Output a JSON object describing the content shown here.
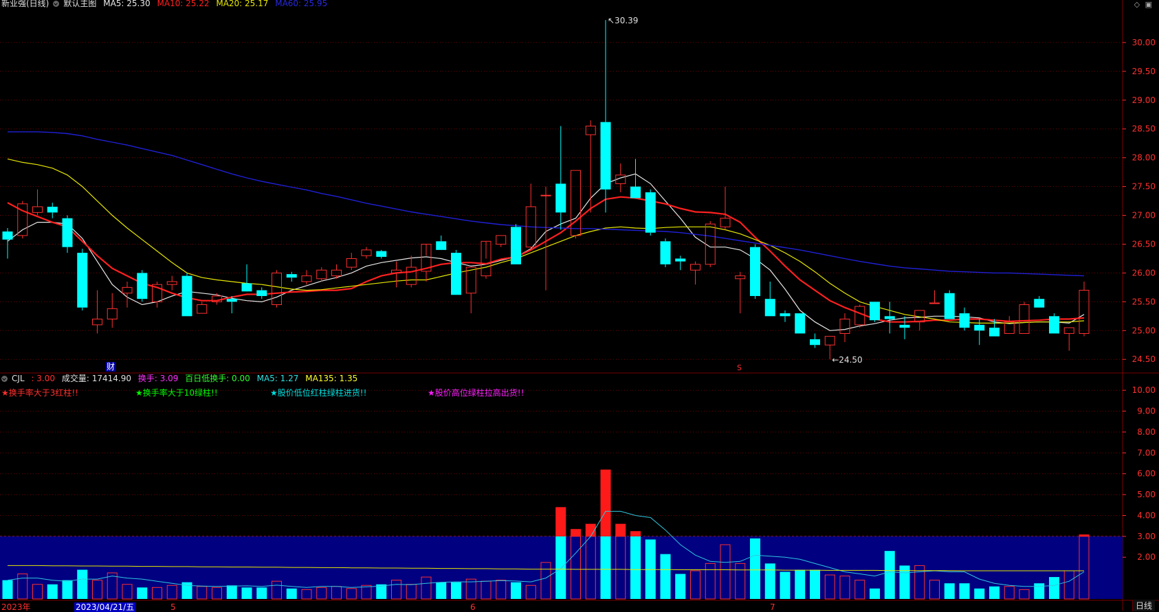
{
  "main_header": {
    "title": "新业强(日线)",
    "template": "默认主图",
    "ma5": "MA5: 25.30",
    "ma10": "MA10: 25.22",
    "ma20": "MA20: 25.17",
    "ma60": "MA60: 25.95"
  },
  "volume_header": {
    "name": "CJL",
    "value": ": 3.00",
    "volume": "成交量: 17414.90",
    "turnover": "换手: 3.09",
    "low_turnover": "百日低换手: 0.00",
    "ma5": "MA5: 1.27",
    "ma135": "MA135: 1.35"
  },
  "signals": [
    {
      "text": "★换手率大于3红柱!!",
      "color": "#ff3030"
    },
    {
      "text": "★换手率大于10绿柱!!",
      "color": "#00ff00"
    },
    {
      "text": "★股价低位红柱绿柱进货!!",
      "color": "#00e0e0"
    },
    {
      "text": "★股价高位绿柱拉高出货!!",
      "color": "#ff20ff"
    }
  ],
  "colors": {
    "up": "#ff3030",
    "down": "#00ffff",
    "ma5": "#e8e8e8",
    "ma10": "#ff2020",
    "ma20": "#e8e800",
    "ma60": "#2020d8",
    "grid": "#7a0000",
    "axis_text": "#ff3030",
    "band": "#000080"
  },
  "bottom_labels": {
    "year": "2023年",
    "cursor_date": "2023/04/21/五",
    "m5": "5",
    "m6": "6",
    "m7": "7",
    "corner": "日线"
  },
  "markers": {
    "cai": "财",
    "s": "S"
  },
  "icons": [
    "diamond-icon",
    "window-icon"
  ],
  "chart_data": [
    {
      "type": "candlestick",
      "title": "",
      "ylim": [
        24.3,
        30.5
      ],
      "y_ticks": [
        24.5,
        25.0,
        25.5,
        26.0,
        26.5,
        27.0,
        27.5,
        28.0,
        28.5,
        29.0,
        29.5,
        30.0
      ],
      "annotations": [
        {
          "text": "30.39",
          "value": 30.39
        },
        {
          "text": "24.50",
          "value": 24.5
        }
      ],
      "ohlc": [
        [
          26.72,
          26.78,
          26.25,
          26.58
        ],
        [
          26.65,
          27.25,
          26.6,
          27.2
        ],
        [
          27.05,
          27.45,
          27.0,
          27.15
        ],
        [
          27.15,
          27.22,
          26.95,
          27.05
        ],
        [
          26.95,
          27.0,
          26.35,
          26.45
        ],
        [
          26.35,
          26.42,
          25.35,
          25.4
        ],
        [
          25.1,
          25.7,
          24.95,
          25.2
        ],
        [
          25.2,
          25.65,
          25.05,
          25.38
        ],
        [
          25.65,
          25.85,
          25.4,
          25.75
        ],
        [
          26.0,
          26.05,
          25.5,
          25.55
        ],
        [
          25.5,
          25.85,
          25.4,
          25.8
        ],
        [
          25.8,
          25.95,
          25.7,
          25.85
        ],
        [
          25.95,
          26.0,
          25.25,
          25.25
        ],
        [
          25.3,
          25.5,
          25.3,
          25.45
        ],
        [
          25.5,
          25.65,
          25.45,
          25.6
        ],
        [
          25.55,
          25.6,
          25.3,
          25.5
        ],
        [
          25.82,
          26.15,
          25.7,
          25.68
        ],
        [
          25.7,
          25.75,
          25.55,
          25.6
        ],
        [
          25.45,
          26.05,
          25.4,
          26.0
        ],
        [
          25.98,
          26.02,
          25.85,
          25.92
        ],
        [
          25.85,
          26.05,
          25.8,
          25.95
        ],
        [
          25.9,
          26.1,
          25.85,
          26.05
        ],
        [
          25.95,
          26.15,
          25.9,
          26.05
        ],
        [
          26.1,
          26.35,
          26.05,
          26.25
        ],
        [
          26.3,
          26.45,
          26.25,
          26.4
        ],
        [
          26.38,
          26.4,
          26.25,
          26.28
        ],
        [
          26.0,
          26.2,
          25.75,
          26.05
        ],
        [
          25.8,
          26.3,
          25.75,
          26.1
        ],
        [
          26.03,
          26.3,
          25.85,
          26.5
        ],
        [
          26.55,
          26.65,
          26.4,
          26.4
        ],
        [
          26.35,
          26.4,
          25.62,
          25.62
        ],
        [
          25.65,
          26.1,
          25.3,
          26.1
        ],
        [
          25.95,
          26.25,
          25.9,
          26.55
        ],
        [
          26.5,
          26.65,
          26.45,
          26.65
        ],
        [
          26.8,
          26.85,
          26.15,
          26.15
        ],
        [
          26.45,
          27.55,
          26.4,
          27.15
        ],
        [
          27.35,
          27.5,
          25.7,
          27.35
        ],
        [
          27.55,
          28.55,
          26.75,
          27.05
        ],
        [
          26.65,
          27.78,
          26.6,
          27.78
        ],
        [
          28.4,
          28.65,
          27.05,
          28.55
        ],
        [
          28.62,
          30.39,
          27.05,
          27.45
        ],
        [
          27.55,
          27.9,
          27.4,
          27.7
        ],
        [
          27.5,
          27.98,
          27.38,
          27.3
        ],
        [
          27.4,
          27.45,
          26.65,
          26.7
        ],
        [
          26.55,
          26.6,
          26.1,
          26.15
        ],
        [
          26.25,
          26.3,
          26.05,
          26.2
        ],
        [
          26.05,
          26.2,
          25.8,
          26.15
        ],
        [
          26.15,
          26.9,
          26.1,
          26.85
        ],
        [
          26.8,
          27.5,
          26.75,
          26.95
        ],
        [
          25.9,
          26.02,
          25.3,
          25.95
        ],
        [
          26.45,
          26.5,
          25.55,
          25.6
        ],
        [
          25.55,
          25.85,
          25.25,
          25.25
        ],
        [
          25.3,
          25.35,
          25.15,
          25.25
        ],
        [
          25.3,
          25.3,
          24.95,
          24.95
        ],
        [
          24.85,
          24.95,
          24.7,
          24.75
        ],
        [
          24.75,
          24.9,
          24.5,
          24.9
        ],
        [
          24.95,
          25.3,
          24.8,
          25.2
        ],
        [
          25.1,
          25.45,
          25.05,
          25.42
        ],
        [
          25.5,
          25.5,
          25.15,
          25.18
        ],
        [
          25.25,
          25.5,
          24.95,
          25.2
        ],
        [
          25.1,
          25.25,
          24.85,
          25.05
        ],
        [
          25.15,
          25.35,
          25.0,
          25.35
        ],
        [
          25.48,
          25.7,
          25.48,
          25.48
        ],
        [
          25.65,
          25.7,
          25.25,
          25.2
        ],
        [
          25.3,
          25.4,
          25.0,
          25.05
        ],
        [
          25.1,
          25.2,
          24.75,
          25.0
        ],
        [
          25.05,
          25.2,
          24.9,
          24.9
        ],
        [
          24.95,
          25.25,
          24.95,
          25.15
        ],
        [
          24.95,
          25.5,
          24.95,
          25.45
        ],
        [
          25.55,
          25.6,
          25.4,
          25.4
        ],
        [
          25.25,
          25.3,
          24.95,
          24.95
        ],
        [
          24.95,
          25.05,
          24.65,
          25.05
        ],
        [
          24.95,
          25.85,
          24.9,
          25.7
        ]
      ],
      "series": [
        {
          "name": "MA5",
          "values": [
            26.55,
            26.75,
            26.88,
            26.88,
            26.85,
            26.6,
            26.2,
            25.8,
            25.58,
            25.45,
            25.5,
            25.6,
            25.68,
            25.65,
            25.62,
            25.56,
            25.52,
            25.5,
            25.58,
            25.7,
            25.78,
            25.86,
            25.92,
            26.0,
            26.12,
            26.18,
            26.22,
            26.26,
            26.28,
            26.25,
            26.18,
            26.12,
            26.15,
            26.22,
            26.28,
            26.42,
            26.72,
            26.85,
            26.95,
            27.3,
            27.55,
            27.65,
            27.72,
            27.55,
            27.25,
            26.95,
            26.62,
            26.45,
            26.45,
            26.4,
            26.25,
            26.05,
            25.72,
            25.35,
            25.15,
            25.0,
            25.02,
            25.08,
            25.12,
            25.18,
            25.22,
            25.23,
            25.25,
            25.25,
            25.24,
            25.22,
            25.15,
            25.12,
            25.14,
            25.15,
            25.15,
            25.13,
            25.28
          ]
        },
        {
          "name": "MA10",
          "values": [
            27.22,
            27.08,
            26.98,
            26.88,
            26.8,
            26.55,
            26.3,
            26.08,
            25.95,
            25.82,
            25.75,
            25.65,
            25.57,
            25.52,
            25.52,
            25.58,
            25.63,
            25.63,
            25.65,
            25.67,
            25.68,
            25.7,
            25.7,
            25.73,
            25.85,
            25.95,
            26.0,
            26.02,
            26.08,
            26.15,
            26.18,
            26.18,
            26.16,
            26.24,
            26.28,
            26.4,
            26.55,
            26.7,
            26.9,
            27.12,
            27.28,
            27.32,
            27.3,
            27.25,
            27.2,
            27.12,
            27.06,
            27.05,
            27.02,
            26.88,
            26.62,
            26.38,
            26.12,
            25.88,
            25.7,
            25.52,
            25.4,
            25.3,
            25.2,
            25.15,
            25.15,
            25.16,
            25.18,
            25.18,
            25.2,
            25.2,
            25.18,
            25.16,
            25.17,
            25.18,
            25.2,
            25.2,
            25.22
          ]
        },
        {
          "name": "MA20",
          "values": [
            27.98,
            27.92,
            27.88,
            27.82,
            27.7,
            27.5,
            27.25,
            27.0,
            26.78,
            26.58,
            26.38,
            26.18,
            26.0,
            25.92,
            25.88,
            25.85,
            25.82,
            25.8,
            25.76,
            25.72,
            25.7,
            25.71,
            25.74,
            25.77,
            25.8,
            25.83,
            25.86,
            25.88,
            25.88,
            25.94,
            26.0,
            26.05,
            26.1,
            26.18,
            26.25,
            26.35,
            26.45,
            26.55,
            26.65,
            26.72,
            26.78,
            26.8,
            26.78,
            26.77,
            26.79,
            26.8,
            26.8,
            26.8,
            26.75,
            26.68,
            26.58,
            26.48,
            26.35,
            26.2,
            26.02,
            25.82,
            25.65,
            25.5,
            25.42,
            25.35,
            25.28,
            25.24,
            25.2,
            25.15,
            25.14,
            25.13,
            25.13,
            25.13,
            25.14,
            25.15,
            25.15,
            25.15,
            25.17
          ]
        },
        {
          "name": "MA60",
          "values": [
            28.45,
            28.45,
            28.45,
            28.44,
            28.42,
            28.38,
            28.32,
            28.27,
            28.22,
            28.16,
            28.1,
            28.04,
            27.96,
            27.88,
            27.8,
            27.72,
            27.65,
            27.59,
            27.54,
            27.49,
            27.44,
            27.38,
            27.33,
            27.27,
            27.21,
            27.16,
            27.11,
            27.06,
            27.02,
            26.98,
            26.94,
            26.9,
            26.87,
            26.84,
            26.82,
            26.8,
            26.79,
            26.78,
            26.77,
            26.77,
            26.76,
            26.75,
            26.74,
            26.73,
            26.72,
            26.7,
            26.67,
            26.64,
            26.6,
            26.56,
            26.52,
            26.48,
            26.44,
            26.4,
            26.35,
            26.3,
            26.25,
            26.2,
            26.16,
            26.12,
            26.09,
            26.07,
            26.05,
            26.03,
            26.02,
            26.01,
            26.0,
            26.0,
            25.99,
            25.98,
            25.97,
            25.96,
            25.95
          ]
        }
      ]
    },
    {
      "type": "bar",
      "title": "",
      "ylim": [
        0,
        10.5
      ],
      "y_ticks": [
        2.0,
        3.0,
        4.0,
        5.0,
        6.0,
        7.0,
        8.0,
        9.0,
        10.0
      ],
      "threshold": 3.0,
      "values": [
        0.9,
        1.2,
        0.7,
        0.7,
        0.9,
        1.4,
        0.9,
        1.25,
        0.7,
        0.55,
        0.55,
        0.65,
        0.8,
        0.6,
        0.55,
        0.65,
        0.55,
        0.55,
        0.85,
        0.5,
        0.45,
        0.55,
        0.6,
        0.5,
        0.65,
        0.7,
        0.9,
        0.7,
        1.05,
        0.8,
        0.8,
        0.95,
        0.85,
        0.9,
        0.8,
        0.65,
        1.75,
        4.4,
        3.35,
        3.6,
        6.2,
        3.6,
        3.25,
        2.85,
        2.15,
        1.2,
        1.35,
        1.7,
        2.6,
        1.7,
        2.9,
        1.7,
        1.3,
        1.4,
        1.4,
        1.15,
        1.1,
        0.9,
        0.5,
        2.3,
        1.6,
        1.6,
        0.9,
        0.75,
        0.75,
        0.5,
        0.6,
        0.6,
        0.45,
        0.75,
        1.05,
        1.35,
        3.09
      ],
      "series": [
        {
          "name": "MA5",
          "values": [
            0.9,
            1.0,
            1.0,
            0.9,
            0.85,
            0.95,
            0.95,
            1.1,
            1.0,
            0.95,
            0.85,
            0.75,
            0.65,
            0.62,
            0.6,
            0.62,
            0.63,
            0.6,
            0.66,
            0.6,
            0.55,
            0.6,
            0.6,
            0.55,
            0.58,
            0.62,
            0.7,
            0.68,
            0.75,
            0.8,
            0.82,
            0.82,
            0.85,
            0.88,
            0.86,
            0.82,
            1.0,
            1.45,
            2.2,
            3.0,
            4.2,
            4.2,
            4.0,
            3.9,
            3.3,
            2.6,
            2.1,
            1.8,
            1.75,
            1.8,
            2.1,
            2.05,
            2.0,
            1.9,
            1.7,
            1.5,
            1.3,
            1.2,
            1.1,
            1.3,
            1.25,
            1.3,
            1.35,
            1.3,
            1.3,
            0.95,
            0.75,
            0.65,
            0.6,
            0.6,
            0.65,
            0.85,
            1.3
          ]
        },
        {
          "name": "MA135",
          "values": [
            1.6,
            1.6,
            1.6,
            1.59,
            1.59,
            1.58,
            1.58,
            1.57,
            1.57,
            1.56,
            1.56,
            1.55,
            1.55,
            1.54,
            1.54,
            1.53,
            1.53,
            1.52,
            1.52,
            1.51,
            1.51,
            1.5,
            1.5,
            1.49,
            1.49,
            1.48,
            1.48,
            1.47,
            1.47,
            1.46,
            1.46,
            1.45,
            1.45,
            1.44,
            1.44,
            1.43,
            1.43,
            1.43,
            1.42,
            1.42,
            1.42,
            1.42,
            1.41,
            1.41,
            1.41,
            1.4,
            1.4,
            1.4,
            1.4,
            1.39,
            1.39,
            1.39,
            1.38,
            1.38,
            1.38,
            1.37,
            1.37,
            1.37,
            1.37,
            1.36,
            1.36,
            1.36,
            1.36,
            1.36,
            1.35,
            1.35,
            1.35,
            1.35,
            1.35,
            1.35,
            1.35,
            1.35,
            1.35
          ]
        }
      ]
    }
  ]
}
